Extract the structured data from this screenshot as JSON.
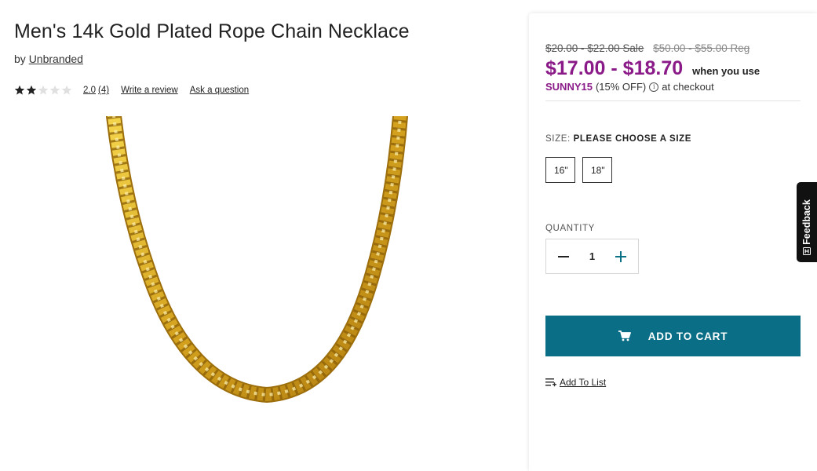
{
  "product": {
    "title": "Men's 14k Gold Plated Rope Chain Necklace",
    "by_prefix": "by",
    "brand": "Unbranded",
    "rating_value": "2.0",
    "rating_stars": 2,
    "rating_max": 5,
    "review_count": "(4)",
    "write_review": "Write a review",
    "ask_question": "Ask a question",
    "image_alt": "gold-rope-chain"
  },
  "pricing": {
    "sale_range": "$20.00 - $22.00 Sale",
    "reg_range": "$50.00 - $55.00 Reg",
    "promo_range": "$17.00 - $18.70",
    "when_you_use": "when you use",
    "coupon_code": "SUNNY15",
    "coupon_off": "(15% OFF)",
    "info_glyph": "i",
    "at_checkout": "at checkout"
  },
  "size": {
    "label": "SIZE:",
    "value": "PLEASE CHOOSE A SIZE",
    "options": [
      "16\"",
      "18\""
    ]
  },
  "quantity": {
    "label": "QUANTITY",
    "value": "1"
  },
  "actions": {
    "add_to_cart": "ADD TO CART",
    "add_to_list": "Add To List"
  },
  "feedback": {
    "label": "Feedback",
    "icon_glyph": "H"
  },
  "colors": {
    "promo_purple": "#8b1a89",
    "cart_teal": "#0a6e86",
    "star_filled": "#222222",
    "star_empty": "#e0e0e0",
    "gold": "#d4a82a"
  }
}
